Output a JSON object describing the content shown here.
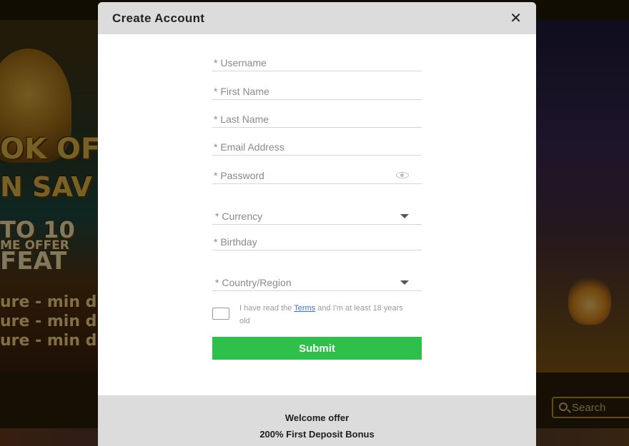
{
  "background": {
    "promo_lines": [
      "OK OF",
      "N SAV",
      "TO 10",
      "ME OFFER",
      "FEAT",
      "ure - min d",
      "ure - min d",
      "ure - min d"
    ],
    "search_label": "Search"
  },
  "modal": {
    "title": "Create Account",
    "close_icon": "close-icon",
    "fields": {
      "username": "* Username",
      "first_name": "* First Name",
      "last_name": "* Last Name",
      "email": "* Email Address",
      "password": "* Password",
      "currency": "* Currency",
      "birthday": "* Birthday",
      "country": "* Country/Region"
    },
    "terms": {
      "before": "I have read the ",
      "link": "Terms",
      "after": " and I'm at least 18 years old"
    },
    "submit_label": "Submit",
    "footer": {
      "title": "Welcome offer",
      "text": "200% First Deposit Bonus"
    }
  },
  "colors": {
    "submit": "#2ec04b",
    "header": "#dcdcdc",
    "link": "#3d6fd6"
  }
}
